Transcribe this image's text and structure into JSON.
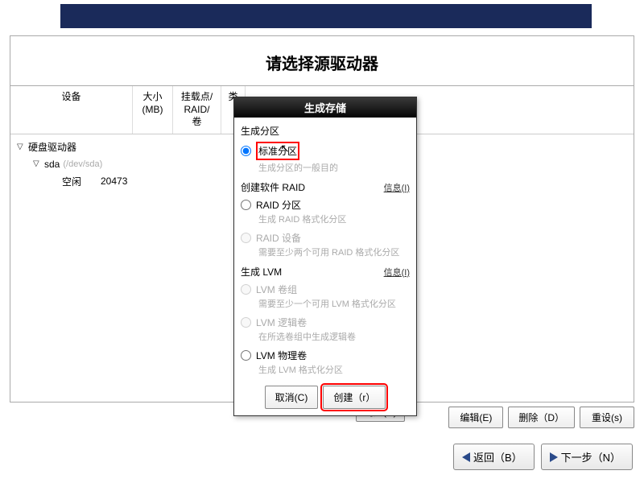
{
  "topTitle": "请选择源驱动器",
  "table": {
    "headers": {
      "device": "设备",
      "size": "大小\n(MB)",
      "mount": "挂载点/\nRAID/卷",
      "type": "类"
    },
    "rows": {
      "root": "硬盘驱动器",
      "sda": "sda",
      "sdaPath": "(/dev/sda)",
      "free": "空闲",
      "freeSize": "20473"
    }
  },
  "dialog": {
    "title": "生成存储",
    "sections": {
      "createPartition": "生成分区",
      "standardPartition": "标准分区",
      "standardDesc": "生成分区的一般目的",
      "createRaid": "创建软件 RAID",
      "raidPartition": "RAID 分区",
      "raidPartitionDesc": "生成 RAID 格式化分区",
      "raidDevice": "RAID 设备",
      "raidDeviceDesc": "需要至少两个可用 RAID 格式化分区",
      "createLvm": "生成 LVM",
      "lvmVg": "LVM 卷组",
      "lvmVgDesc": "需要至少一个可用 LVM 格式化分区",
      "lvmLv": "LVM 逻辑卷",
      "lvmLvDesc": "在所选卷组中生成逻辑卷",
      "lvmPv": "LVM 物理卷",
      "lvmPvDesc": "生成 LVM 格式化分区",
      "info": "信息(I)"
    },
    "buttons": {
      "cancel": "取消(C)",
      "create": "创建（r）"
    }
  },
  "bottomButtons": {
    "create": "创建(C)",
    "edit": "编辑(E)",
    "delete": "删除（D）",
    "reset": "重设(s)"
  },
  "nav": {
    "back": "返回（B）",
    "next": "下一步（N）"
  }
}
